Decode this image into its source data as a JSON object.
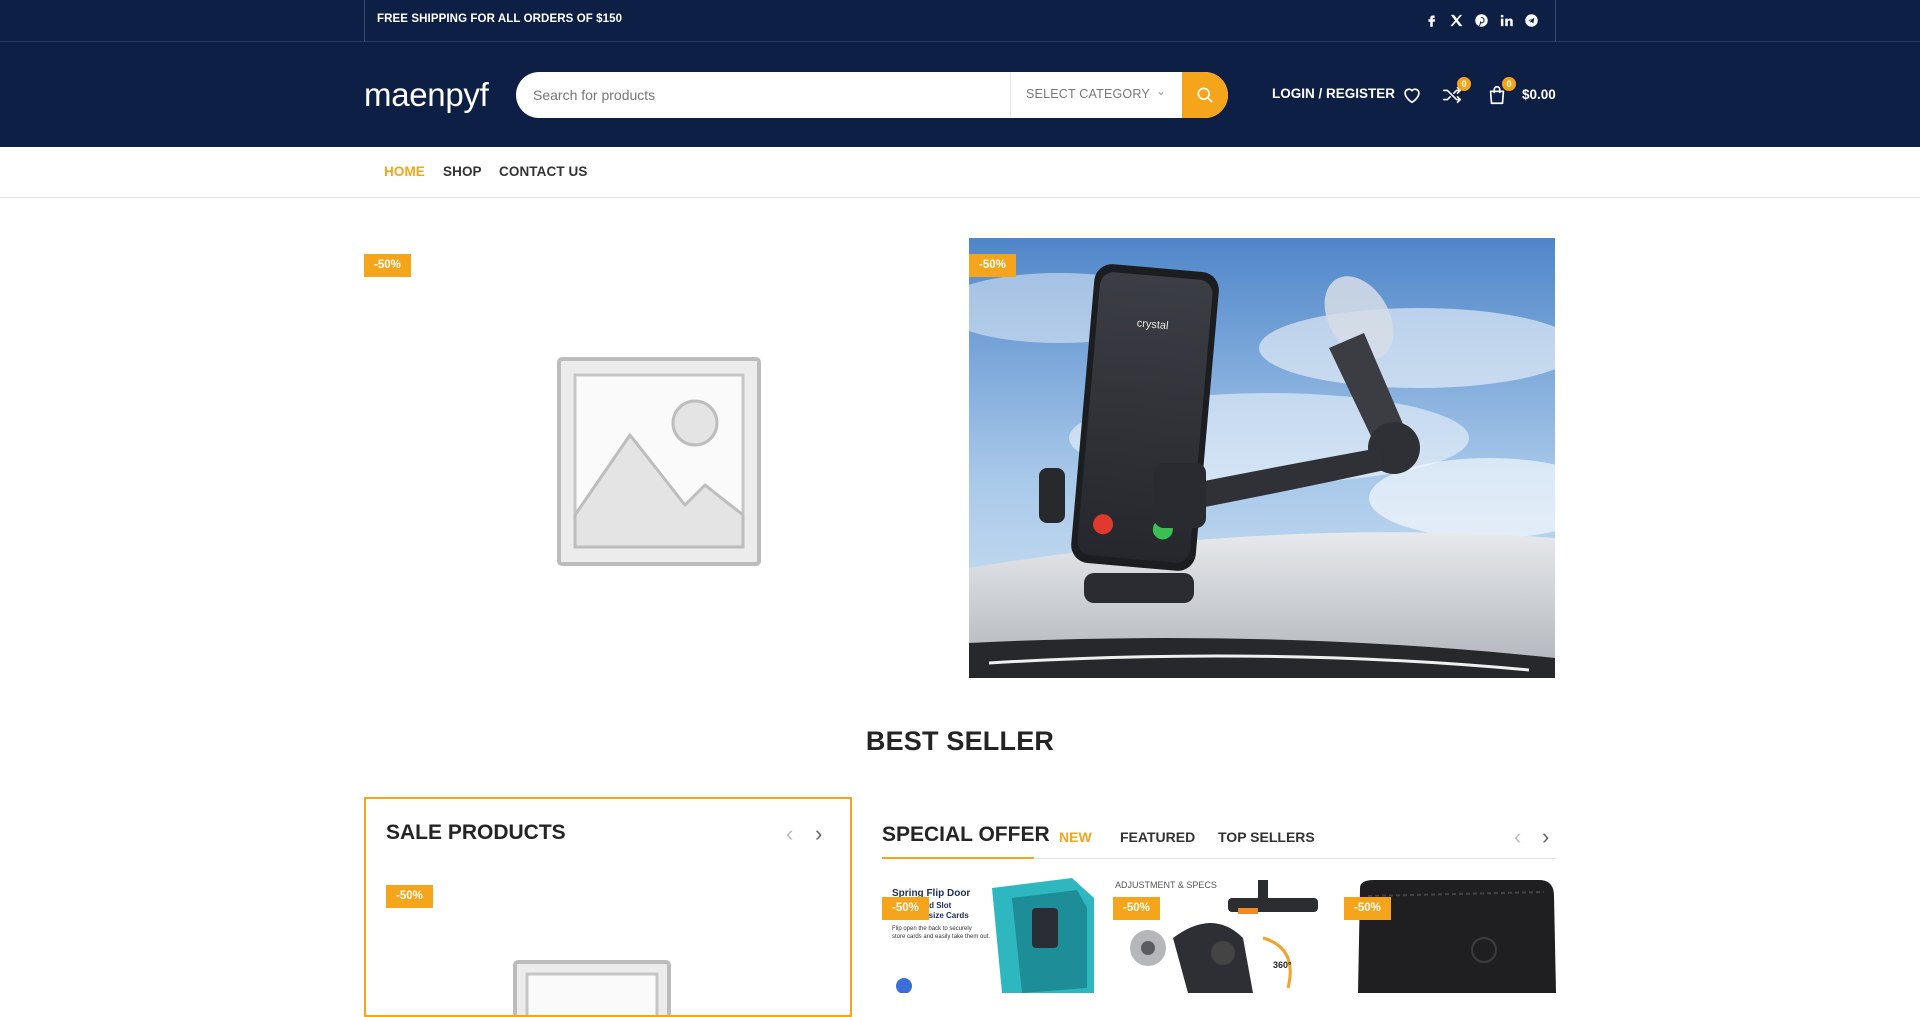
{
  "topbar": {
    "shipping_text": "FREE SHIPPING FOR ALL ORDERS OF $150",
    "socials": [
      "facebook-icon",
      "x-icon",
      "pinterest-icon",
      "linkedin-icon",
      "telegram-icon"
    ]
  },
  "header": {
    "logo": "maenpyf",
    "search_placeholder": "Search for products",
    "category_label": "SELECT CATEGORY",
    "login_label": "LOGIN / REGISTER",
    "compare_count": "0",
    "cart_count": "0",
    "cart_total": "$0.00"
  },
  "nav": {
    "items": [
      "HOME",
      "SHOP",
      "CONTACT US"
    ],
    "active": "HOME"
  },
  "banners": [
    {
      "badge": "-50%",
      "image": "placeholder-image"
    },
    {
      "badge": "-50%",
      "image": "phone-car-mount-image",
      "phone_text": "crystal"
    }
  ],
  "best_seller": {
    "title": "BEST SELLER"
  },
  "sale_products": {
    "title": "SALE PRODUCTS",
    "badge": "-50%"
  },
  "special_offer": {
    "title": "SPECIAL OFFER",
    "tabs": [
      "NEW",
      "FEATURED",
      "TOP SELLERS"
    ],
    "active_tab": "NEW",
    "products": [
      {
        "badge": "-50%",
        "image_text_1": "Spring Flip Door",
        "image_text_2": "rd Slot",
        "image_text_3": "-size Cards",
        "image_text_4": "Flip open the back to securely",
        "image_text_5": "store cards and easily take them out."
      },
      {
        "badge": "-50%",
        "image_text_1": "ADJUSTMENT & SPECS",
        "image_text_2": "360°"
      },
      {
        "badge": "-50%"
      }
    ]
  },
  "colors": {
    "navy": "#0e1f45",
    "accent": "#f4a51c"
  }
}
